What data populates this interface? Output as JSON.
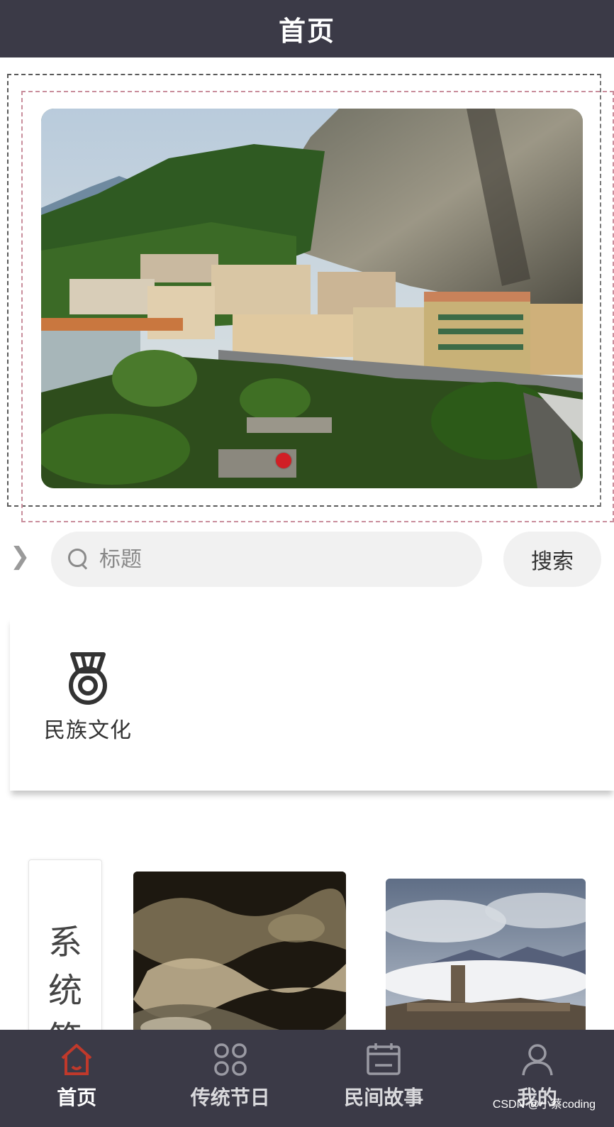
{
  "header": {
    "title": "首页"
  },
  "banner": {
    "indicator_count": 1,
    "active_index": 0
  },
  "search": {
    "placeholder": "标题",
    "button_label": "搜索"
  },
  "categories": [
    {
      "label": "民族文化",
      "icon": "medal-icon"
    }
  ],
  "side_tab": {
    "label": "系统笔"
  },
  "tabbar": {
    "items": [
      {
        "label": "首页",
        "icon": "home-icon",
        "active": true
      },
      {
        "label": "传统节日",
        "icon": "grid-icon",
        "active": false
      },
      {
        "label": "民间故事",
        "icon": "calendar-icon",
        "active": false
      },
      {
        "label": "我的",
        "icon": "user-icon",
        "active": false
      }
    ]
  },
  "watermark": "CSDN @小蔡coding",
  "colors": {
    "bar": "#3b3a47",
    "active_tab_icon": "#c0392b",
    "indicator": "#d11f25"
  }
}
